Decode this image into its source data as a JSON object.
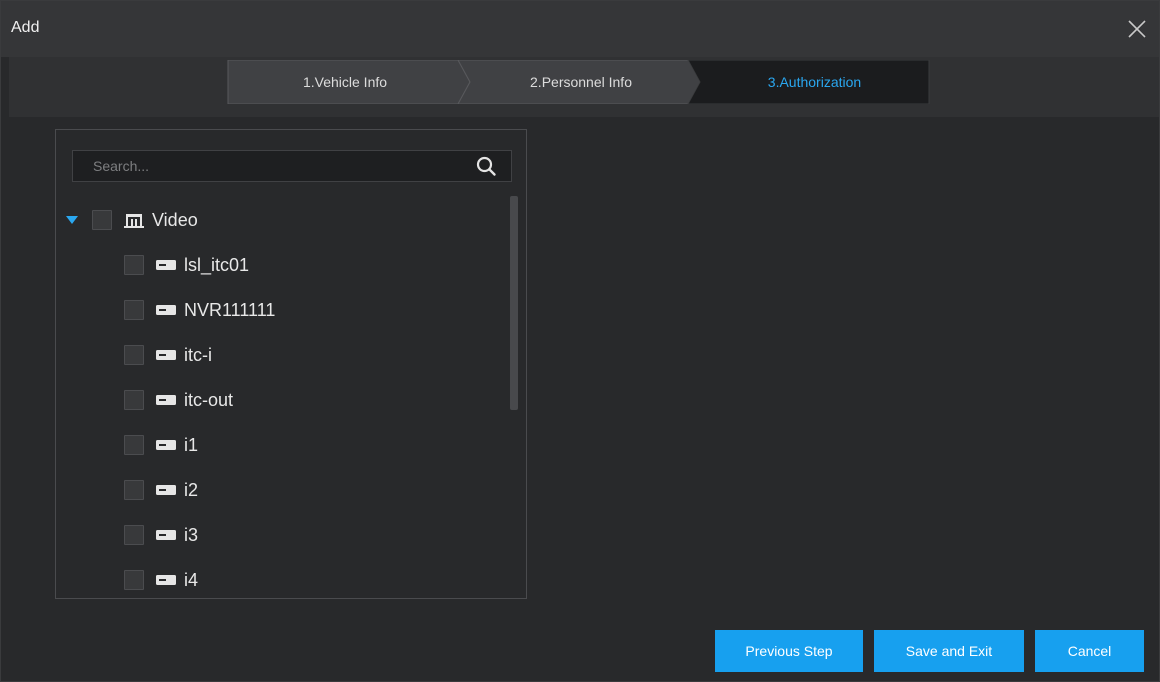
{
  "dialog": {
    "title": "Add"
  },
  "steps": [
    {
      "label": "1.Vehicle Info",
      "active": false
    },
    {
      "label": "2.Personnel Info",
      "active": false
    },
    {
      "label": "3.Authorization",
      "active": true
    }
  ],
  "search": {
    "placeholder": "Search..."
  },
  "tree": {
    "root": {
      "label": "Video",
      "expanded": true,
      "checked": false
    },
    "children": [
      {
        "label": "lsl_itc01",
        "checked": false
      },
      {
        "label": "NVR111111",
        "checked": false
      },
      {
        "label": "itc-i",
        "checked": false
      },
      {
        "label": "itc-out",
        "checked": false
      },
      {
        "label": "i1",
        "checked": false
      },
      {
        "label": "i2",
        "checked": false
      },
      {
        "label": "i3",
        "checked": false
      },
      {
        "label": "i4",
        "checked": false
      }
    ]
  },
  "buttons": {
    "previous": "Previous Step",
    "save_exit": "Save and Exit",
    "cancel": "Cancel"
  },
  "colors": {
    "accent": "#17a0ef",
    "active_step_text": "#2aa7f0",
    "expander": "#2aa7f0"
  },
  "icons": {
    "close": "close-icon",
    "search": "search-icon",
    "expander": "triangle-down-icon",
    "root": "video-organization-icon",
    "device": "device-icon"
  }
}
